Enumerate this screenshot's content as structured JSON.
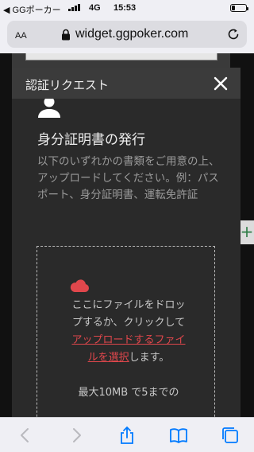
{
  "status_bar": {
    "carrier": "◀ GGポーカー",
    "network": "4G",
    "time": "15:53",
    "battery_level": 0.25
  },
  "address_bar": {
    "text_size_label": "AA",
    "url": "widget.ggpoker.com"
  },
  "modal": {
    "title": "認証リクエスト",
    "section_title": "身分証明書の発行",
    "description": "以下のいずれかの書類をご用意の上、アップロードしてください。例：パスポート、身分証明書、運転免許証",
    "dropzone": {
      "text_before": "ここにファイルをドロップするか、クリックして",
      "link": "アップロードするファイルを選択",
      "text_after": "します。",
      "limit": "最大10MB で5までの"
    }
  },
  "side_tab": {
    "label": "+"
  },
  "colors": {
    "accent_link": "#e0474c",
    "modal_bg": "#2a2a2a",
    "header_bg": "#3b3b3b",
    "ios_blue": "#007aff"
  },
  "icons": {
    "lock": "lock-icon",
    "reload": "reload-icon",
    "close": "close-icon",
    "person": "person-icon",
    "cloud": "cloud-icon",
    "back": "chevron-left-icon",
    "forward": "chevron-right-icon",
    "share": "share-icon",
    "bookmarks": "book-icon",
    "tabs": "tabs-icon"
  }
}
